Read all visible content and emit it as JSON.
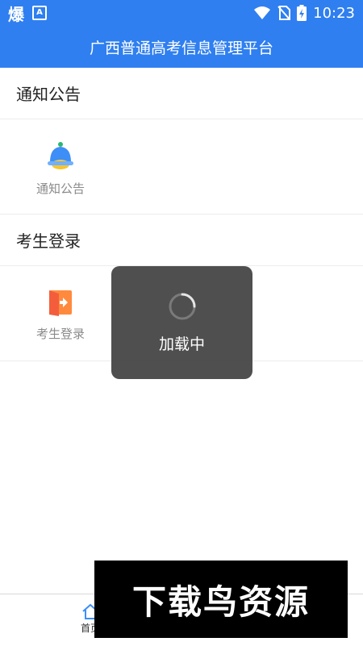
{
  "status_bar": {
    "app_indicator": "爆",
    "a_badge": "A",
    "time": "10:23"
  },
  "header": {
    "title": "广西普通高考信息管理平台"
  },
  "sections": {
    "notice": {
      "title": "通知公告",
      "item_label": "通知公告"
    },
    "login": {
      "title": "考生登录",
      "item_label": "考生登录"
    }
  },
  "loading": {
    "text": "加载中"
  },
  "tabbar": {
    "home_label": "首页"
  },
  "watermark": {
    "text": "下载鸟资源"
  },
  "colors": {
    "primary": "#2f7ff0",
    "loading_bg": "#444444"
  },
  "icons": {
    "notice": "bell-icon",
    "login": "door-login-icon",
    "home": "home-icon",
    "spinner": "spinner-icon"
  }
}
